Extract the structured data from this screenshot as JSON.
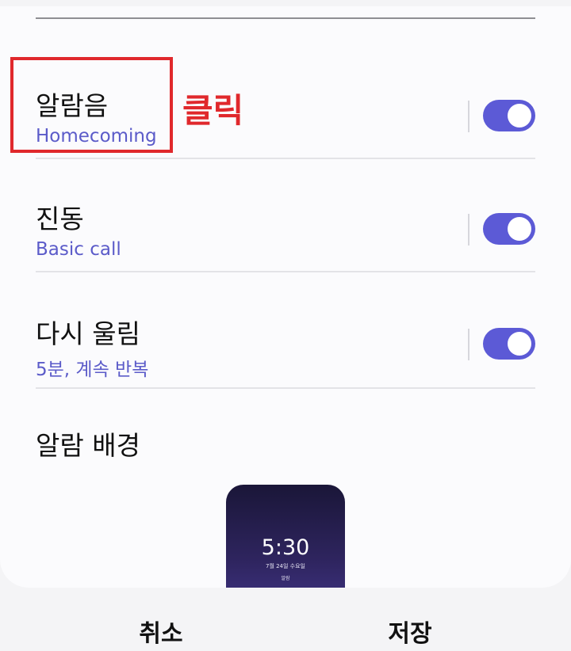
{
  "settings": {
    "rows": [
      {
        "title": "알람음",
        "subtitle": "Homecoming",
        "enabled": true
      },
      {
        "title": "진동",
        "subtitle": "Basic call",
        "enabled": true
      },
      {
        "title": "다시 울림",
        "subtitle": "5분, 계속 반복",
        "enabled": true
      }
    ],
    "background_title": "알람 배경"
  },
  "annotation": {
    "click_label": "클릭",
    "color": "#e0282c"
  },
  "preview": {
    "time": "5:30",
    "date": "7월 24일 수요일",
    "label": "알람"
  },
  "footer": {
    "cancel_label": "취소",
    "save_label": "저장"
  },
  "colors": {
    "accent": "#5c5ad6",
    "subtitle": "#5b5bc9"
  }
}
